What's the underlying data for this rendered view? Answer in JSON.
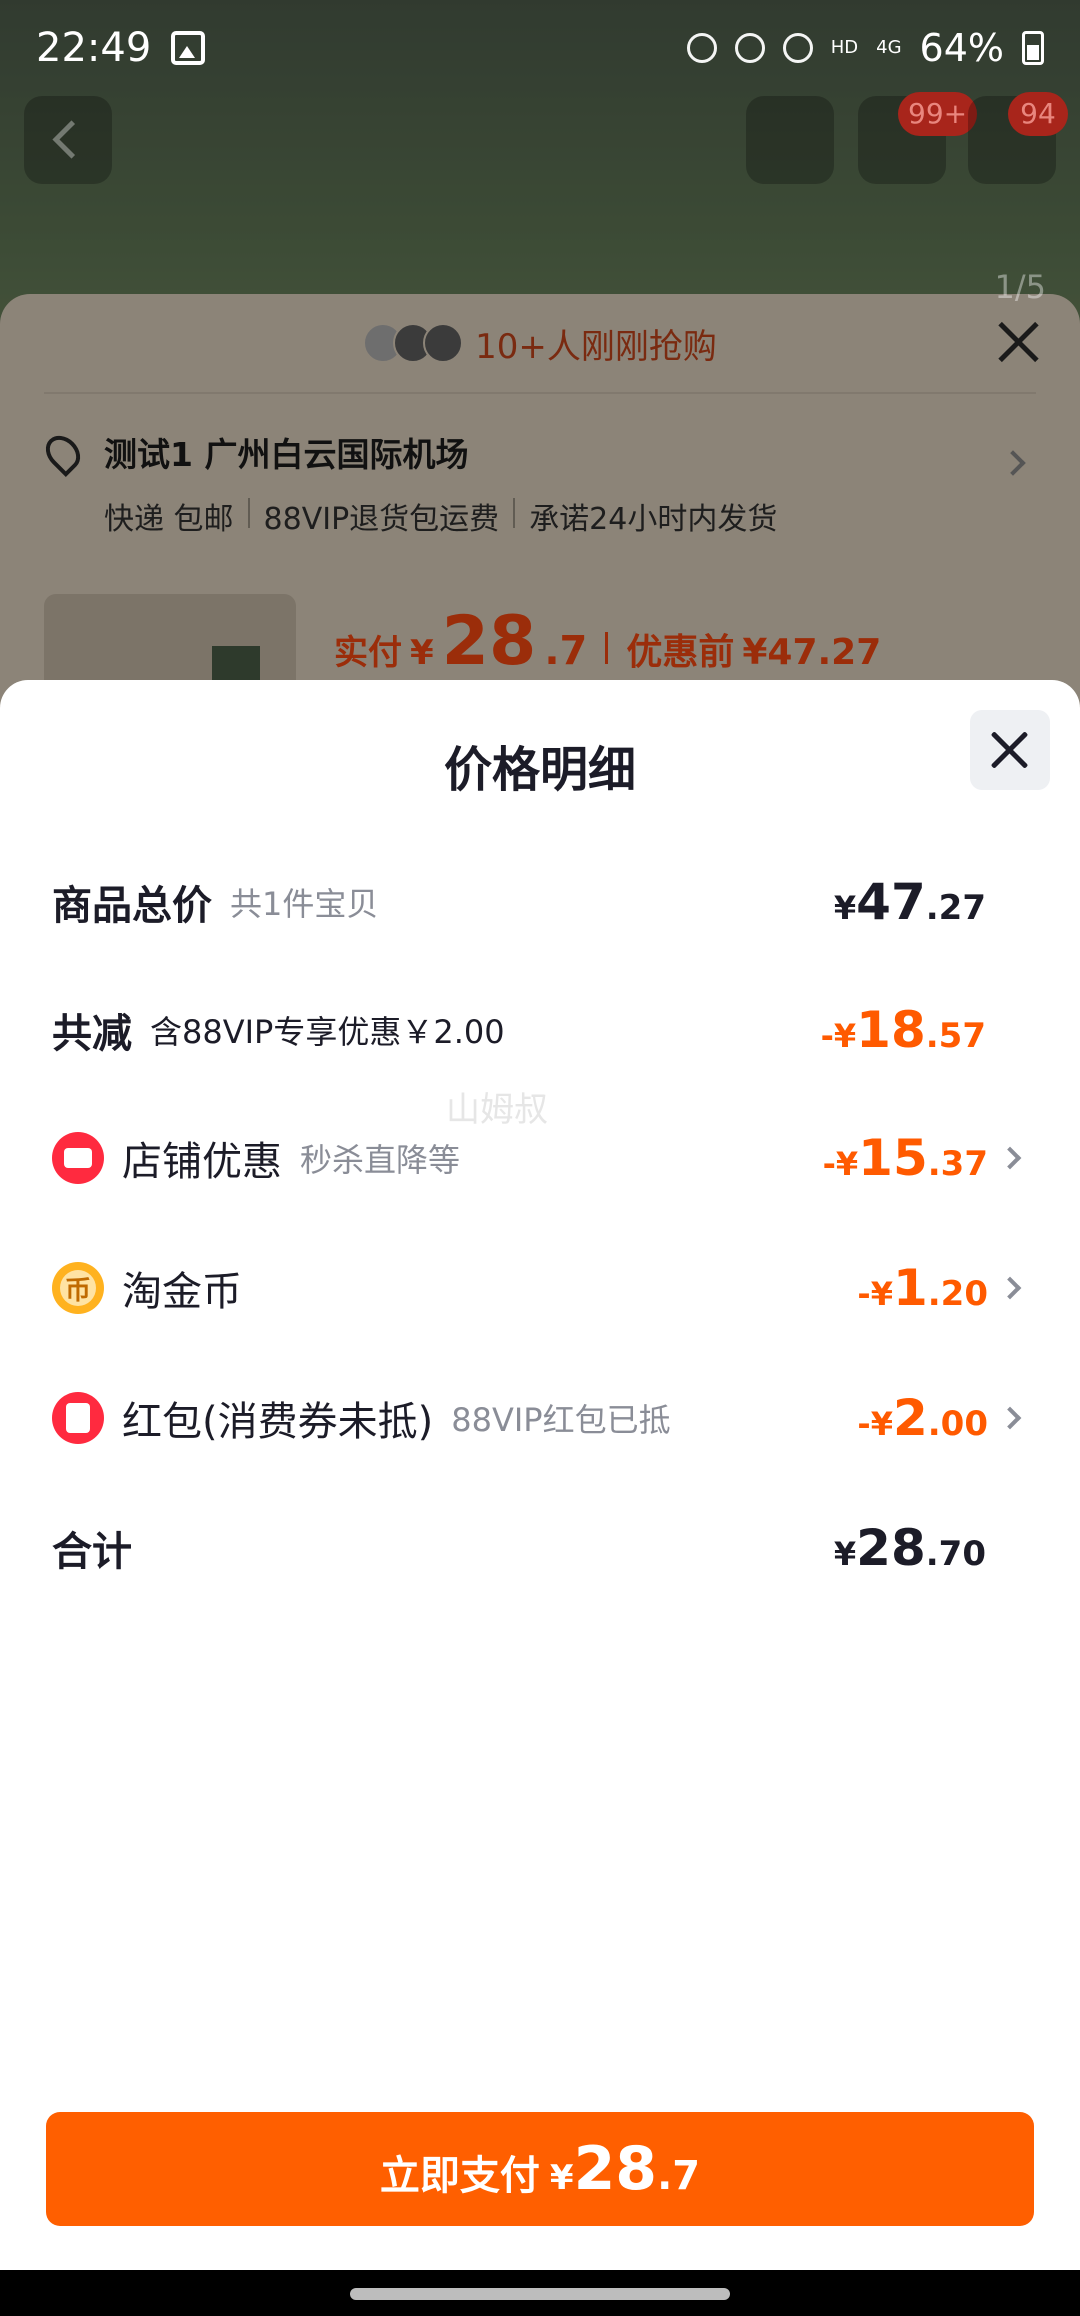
{
  "status_bar": {
    "time": "22:49",
    "battery": "64%",
    "network": "4G",
    "hd": "HD"
  },
  "top_nav": {
    "cart_badge": "99+",
    "more_badge": "94",
    "page_indicator": "1/5"
  },
  "order_panel": {
    "buyers_text": "10+人刚刚抢购",
    "address_name": "测试1 广州白云国际机场",
    "shipping_tags": [
      "快递 包邮",
      "88VIP退货包运费",
      "承诺24小时内发货"
    ],
    "pay_label": "实付",
    "pay_currency": "¥",
    "pay_int": "28",
    "pay_dec": ".7",
    "before_label": "优惠前",
    "before_price": "¥47.27"
  },
  "sheet": {
    "title": "价格明细",
    "total": {
      "label": "商品总价",
      "hint": "共1件宝贝",
      "cur": "¥",
      "int": "47",
      "dec": ".27"
    },
    "reduced": {
      "label": "共减",
      "hint": "含88VIP专享优惠￥2.00",
      "cur": "-¥",
      "int": "18",
      "dec": ".57"
    },
    "shop_discount": {
      "label": "店铺优惠",
      "hint": "秒杀直降等",
      "cur": "-¥",
      "int": "15",
      "dec": ".37",
      "icon": "shop-icon"
    },
    "taojinbi": {
      "label": "淘金币",
      "cur": "-¥",
      "int": "1",
      "dec": ".20",
      "icon": "coin-icon"
    },
    "red_packet": {
      "label": "红包(消费券未抵)",
      "hint": "88VIP红包已抵",
      "cur": "-¥",
      "int": "2",
      "dec": ".00",
      "icon": "red-packet-icon"
    },
    "sum": {
      "label": "合计",
      "cur": "¥",
      "int": "28",
      "dec": ".70"
    },
    "watermark": "山姆叔"
  },
  "pay_button": {
    "label": "立即支付",
    "cur": "¥",
    "int": "28",
    "dec": ".7"
  },
  "colors": {
    "accent": "#ff5f00",
    "price_orange": "#ff5a00",
    "text": "#1c1c28",
    "hint": "#8a8d97"
  }
}
